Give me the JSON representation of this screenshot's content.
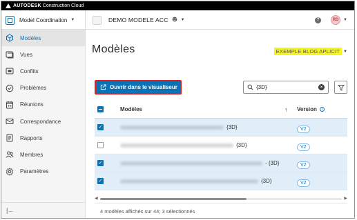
{
  "brand": {
    "strong": "AUTODESK",
    "rest": "Construction Cloud"
  },
  "header": {
    "module_label": "Model Coordination",
    "project_name": "DEMO MODELE ACC",
    "avatar_initials": "RD",
    "help_glyph": "?"
  },
  "sidebar": {
    "items": [
      {
        "label": "Modèles",
        "icon": "cube-icon",
        "active": true
      },
      {
        "label": "Vues",
        "icon": "views-icon",
        "active": false
      },
      {
        "label": "Conflits",
        "icon": "clash-icon",
        "active": false
      },
      {
        "label": "Problèmes",
        "icon": "issues-icon",
        "active": false
      },
      {
        "label": "Réunions",
        "icon": "meetings-icon",
        "active": false
      },
      {
        "label": "Correspondance",
        "icon": "mail-icon",
        "active": false
      },
      {
        "label": "Rapports",
        "icon": "reports-icon",
        "active": false
      },
      {
        "label": "Membres",
        "icon": "members-icon",
        "active": false
      },
      {
        "label": "Paramètres",
        "icon": "settings-icon",
        "active": false
      }
    ],
    "collapse_glyph": "|←"
  },
  "main": {
    "title": "Modèles",
    "blog_tag": "EXEMPLE BLOG APLICIT",
    "open_button_label": "Ouvrir dans le visualiseur",
    "search_value": "{3D}",
    "table": {
      "col_name": "Modèles",
      "col_version": "Version",
      "rows": [
        {
          "suffix": "{3D}",
          "version": "V2",
          "selected": true
        },
        {
          "suffix": "{3D}",
          "version": "V2",
          "selected": false
        },
        {
          "suffix": "- {3D}",
          "version": "V2",
          "selected": true
        },
        {
          "suffix": "{3D}",
          "version": "V2",
          "selected": true
        }
      ]
    },
    "footer": "4 modèles affichés sur 44; 3 sélectionnés"
  },
  "colors": {
    "accent": "#0b72b5",
    "highlight": "#f5f51a",
    "button_border": "#e02020",
    "selected_row": "#e1eef9"
  }
}
